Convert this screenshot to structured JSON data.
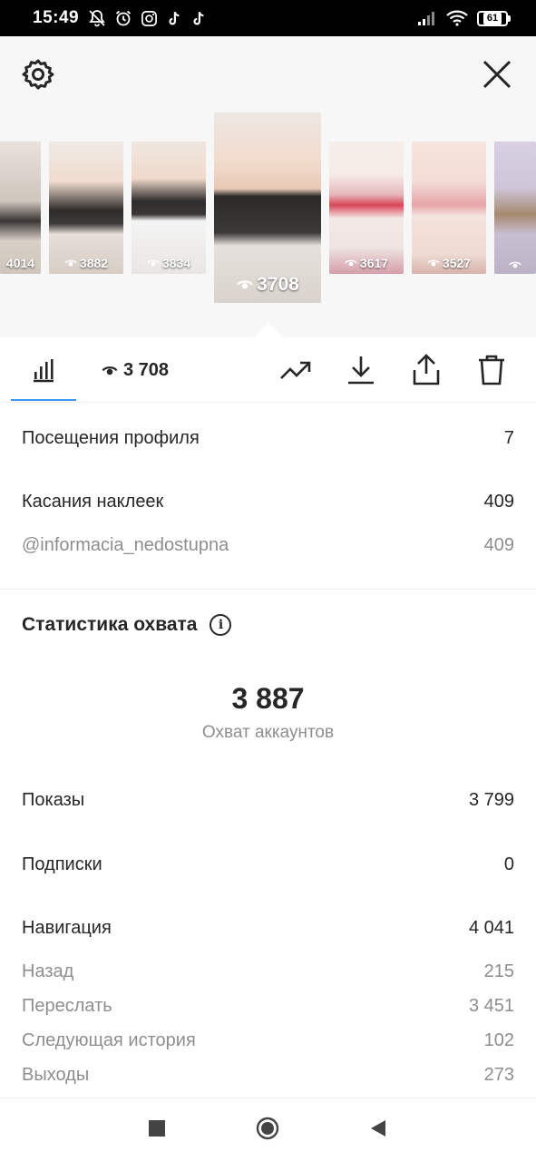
{
  "status_bar": {
    "time": "15:49",
    "battery": "61",
    "icons": [
      "mute-bell-icon",
      "alarm-icon",
      "instagram-icon",
      "tiktok-icon",
      "tiktok-icon",
      "signal-icon",
      "wifi-icon",
      "battery-icon"
    ]
  },
  "header": {
    "settings_icon": "gear-icon",
    "close_icon": "close-icon"
  },
  "stories": [
    {
      "views": "4014"
    },
    {
      "views": "3882"
    },
    {
      "views": "3834"
    },
    {
      "views": "3708",
      "selected": true
    },
    {
      "views": "3617"
    },
    {
      "views": "3527"
    },
    {
      "views": ""
    }
  ],
  "toolbar": {
    "insights_icon": "bar-chart-icon",
    "views_icon": "eye-icon",
    "views_count": "3 708",
    "promote_icon": "trending-up-icon",
    "download_icon": "download-icon",
    "share_icon": "share-icon",
    "delete_icon": "trash-icon",
    "accent_color": "#3897f0"
  },
  "metrics": {
    "profile_visits": {
      "label": "Посещения профиля",
      "value": "7"
    },
    "sticker_taps": {
      "label": "Касания наклеек",
      "value": "409"
    },
    "sticker_mention": {
      "label": "@informacia_nedostupna",
      "value": "409"
    }
  },
  "reach": {
    "title": "Статистика охвата",
    "value": "3 887",
    "label": "Охват аккаунтов",
    "impressions": {
      "label": "Показы",
      "value": "3 799"
    },
    "follows": {
      "label": "Подписки",
      "value": "0"
    },
    "navigation": {
      "label": "Навигация",
      "value": "4 041"
    },
    "back": {
      "label": "Назад",
      "value": "215"
    },
    "forward": {
      "label": "Переслать",
      "value": "3 451"
    },
    "next_story": {
      "label": "Следующая история",
      "value": "102"
    },
    "exits": {
      "label": "Выходы",
      "value": "273"
    }
  },
  "nav_bar": {
    "recents_icon": "square-icon",
    "home_icon": "circle-icon",
    "back_icon": "back-triangle-icon"
  }
}
